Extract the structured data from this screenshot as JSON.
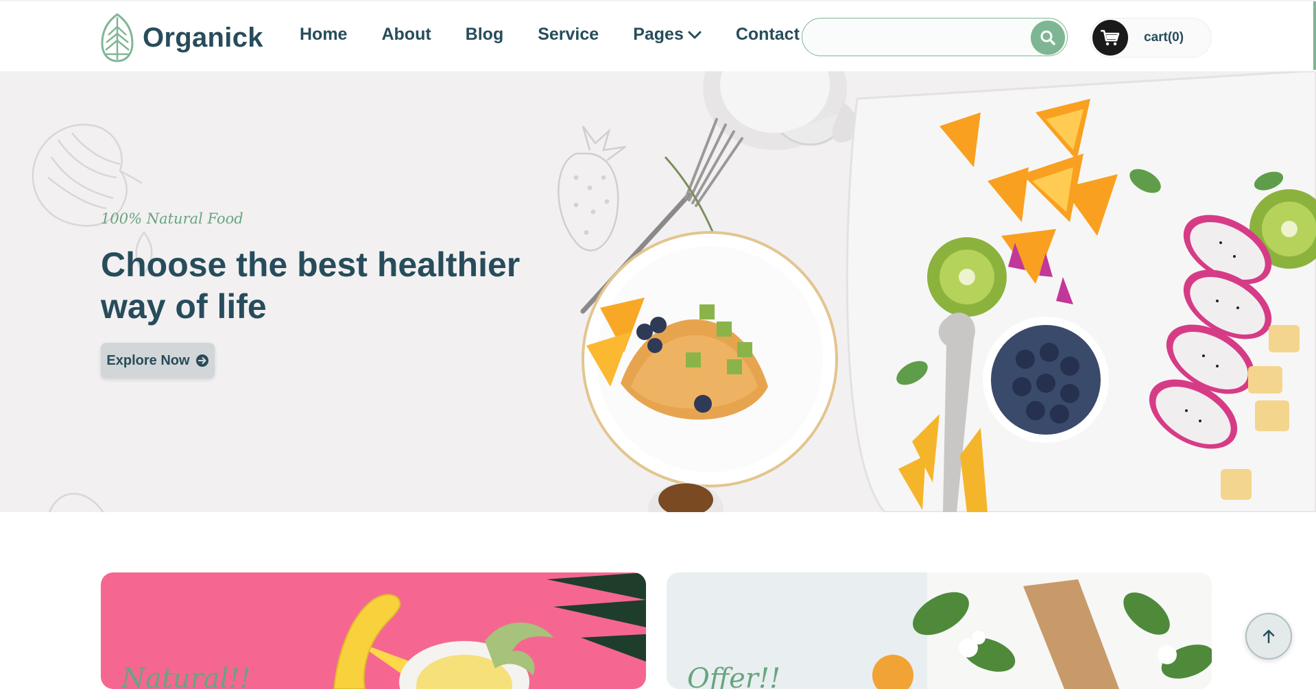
{
  "header": {
    "brand": "Organick",
    "nav": [
      {
        "label": "Home"
      },
      {
        "label": "About"
      },
      {
        "label": "Blog"
      },
      {
        "label": "Service"
      },
      {
        "label": "Pages"
      },
      {
        "label": "Contact"
      }
    ],
    "search": {
      "placeholder": "",
      "value": ""
    },
    "cart_label": "cart(0)"
  },
  "hero": {
    "kicker": "100% Natural Food",
    "title": "Choose the best healthier way of life",
    "cta": "Explore Now"
  },
  "offers": [
    {
      "kicker": "Natural!!"
    },
    {
      "kicker": "Offer!!"
    }
  ],
  "colors": {
    "primary": "#274c5b",
    "accent": "#7eb693",
    "hero_bg": "#f2f0f1",
    "card_pink": "#f56790",
    "card_light": "#e9eff0"
  },
  "icons": {
    "logo": "leaf-logo-icon",
    "pages_dropdown": "chevron-down-icon",
    "search": "search-icon",
    "cart": "cart-icon",
    "cta": "arrow-circle-right-icon",
    "back_to_top": "arrow-up-icon"
  }
}
